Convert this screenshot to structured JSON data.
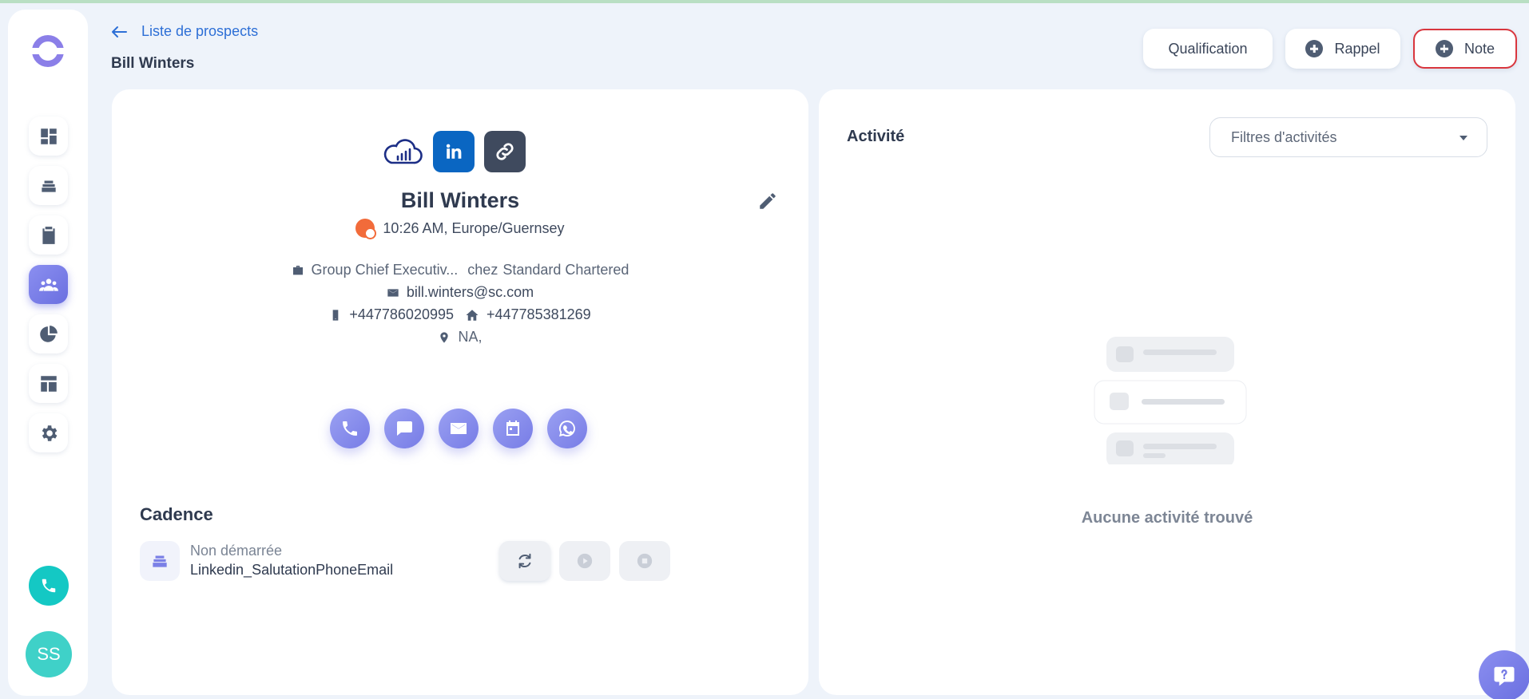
{
  "header": {
    "back_label": "Liste de prospects",
    "page_title": "Bill Winters",
    "buttons": {
      "qualification": "Qualification",
      "rappel": "Rappel",
      "note": "Note"
    }
  },
  "sidebar": {
    "items": [
      {
        "icon": "dashboard-icon"
      },
      {
        "icon": "layers-icon"
      },
      {
        "icon": "clipboard-icon"
      },
      {
        "icon": "people-icon",
        "active": true
      },
      {
        "icon": "pie-chart-icon"
      },
      {
        "icon": "layout-icon"
      },
      {
        "icon": "gear-icon"
      }
    ],
    "avatar_initials": "SS"
  },
  "prospect": {
    "name": "Bill Winters",
    "local_time": "10:26 AM, Europe/Guernsey",
    "job_title": "Group Chief Executiv...",
    "company_prefix": "chez",
    "company": "Standard Chartered",
    "email": "bill.winters@sc.com",
    "mobile": "+447786020995",
    "home_phone": "+447785381269",
    "location": "NA,"
  },
  "cadence": {
    "title": "Cadence",
    "status": "Non démarrée",
    "name": "Linkedin_SalutationPhoneEmail"
  },
  "activity": {
    "title": "Activité",
    "filter_placeholder": "Filtres d'activités",
    "empty_message": "Aucune activité trouvé"
  },
  "colors": {
    "accent": "#777ce6",
    "link": "#2d6fd6",
    "note_border": "#d9363e",
    "call_fab": "#14c8c4",
    "linkedin": "#0a66c2"
  }
}
